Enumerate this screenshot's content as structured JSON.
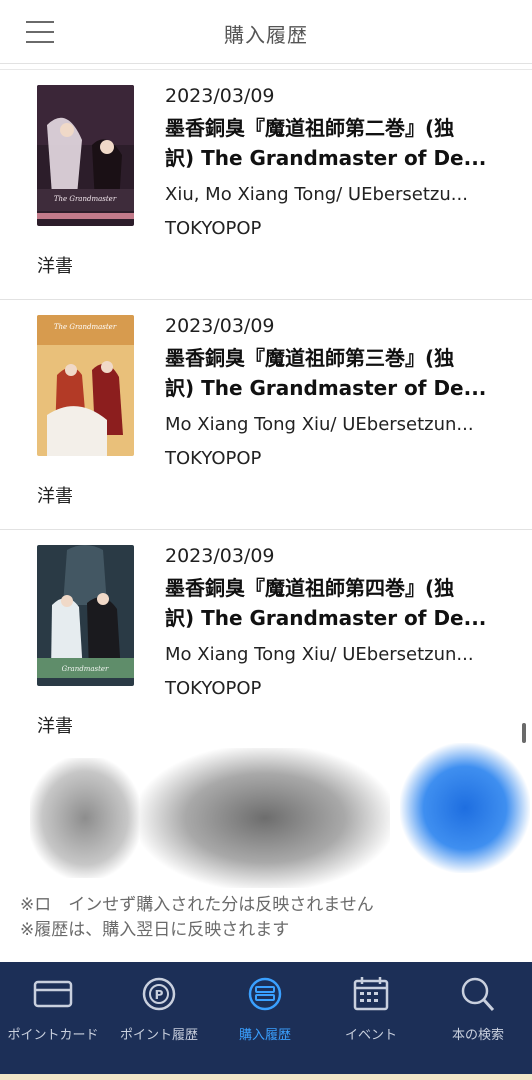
{
  "header": {
    "title": "購入履歴"
  },
  "items": [
    {
      "date": "2023/03/09",
      "title": "墨香銅臭『魔道祖師第二巻』(独\n訳) The Grandmaster of De...",
      "author": "Xiu, Mo Xiang Tong/ UEbersetzu...",
      "publisher": "TOKYOPOP",
      "category": "洋書",
      "cover_colors": [
        "#2c1d2a",
        "#c27a8a"
      ]
    },
    {
      "date": "2023/03/09",
      "title": "墨香銅臭『魔道祖師第三巻』(独\n訳) The Grandmaster of De...",
      "author": "Mo Xiang Tong Xiu/ UEbersetzun...",
      "publisher": "TOKYOPOP",
      "category": "洋書",
      "cover_colors": [
        "#b34a2a",
        "#e9c07a"
      ]
    },
    {
      "date": "2023/03/09",
      "title": "墨香銅臭『魔道祖師第四巻』(独\n訳) The Grandmaster of De...",
      "author": "Mo Xiang Tong Xiu/ UEbersetzun...",
      "publisher": "TOKYOPOP",
      "category": "洋書",
      "cover_colors": [
        "#1f2b36",
        "#5f8d6a"
      ]
    }
  ],
  "notes": [
    "※ロ　インせず購入された分は反映されません",
    "※履歴は、購入翌日に反映されます"
  ],
  "tabbar": {
    "tabs": [
      {
        "label": "ポイントカード",
        "icon": "card-icon"
      },
      {
        "label": "ポイント履歴",
        "icon": "point-history-icon"
      },
      {
        "label": "購入履歴",
        "icon": "purchase-history-icon",
        "active": true
      },
      {
        "label": "イベント",
        "icon": "calendar-icon"
      },
      {
        "label": "本の検索",
        "icon": "search-icon"
      }
    ],
    "colors": {
      "background": "#1c2f57",
      "active": "#3aa0ff",
      "inactive": "#c9d0de"
    }
  }
}
